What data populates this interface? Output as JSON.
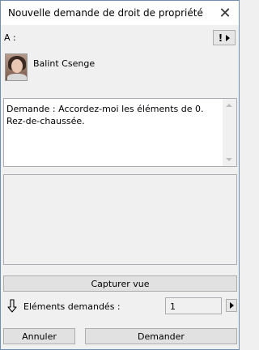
{
  "window": {
    "title": "Nouvelle demande de droit de propriété",
    "close_glyph": "✕"
  },
  "recipient_section": {
    "to_label": "A :",
    "priority_glyph": "!",
    "recipient_name": "Balint Csenge"
  },
  "message": {
    "text": "Demande : Accordez-moi les éléments de 0. Rez-de-chaussée."
  },
  "capture": {
    "label": "Capturer vue"
  },
  "elements": {
    "label": "Eléments demandés :",
    "count": "1"
  },
  "actions": {
    "cancel_label": "Annuler",
    "request_label": "Demander"
  },
  "icons": {
    "close": "close-icon",
    "priority": "exclamation-icon",
    "menu_arrow": "triangle-right-icon",
    "elements_indicator": "down-arrow-icon"
  }
}
